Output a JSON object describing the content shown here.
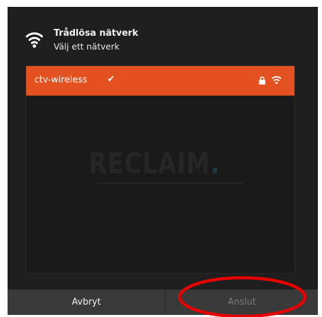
{
  "dialog": {
    "title": "Trådlösa nätverk",
    "subtitle": "Välj ett nätverk",
    "header_icon": "wifi-icon"
  },
  "networks": [
    {
      "name": "ctv-wireless",
      "selected": true,
      "status_icons": [
        "check-icon",
        "lock-icon",
        "wifi-signal-icon"
      ]
    }
  ],
  "watermark": {
    "text": "RECLAIM",
    "dot": "."
  },
  "footer": {
    "cancel_label": "Avbryt",
    "connect_label": "Anslut"
  },
  "colors": {
    "dialog_bg": "#1e1e1e",
    "selected_row": "#e2511f",
    "footer_bg": "#3a3a3a",
    "annotation_circle": "#e60000"
  }
}
